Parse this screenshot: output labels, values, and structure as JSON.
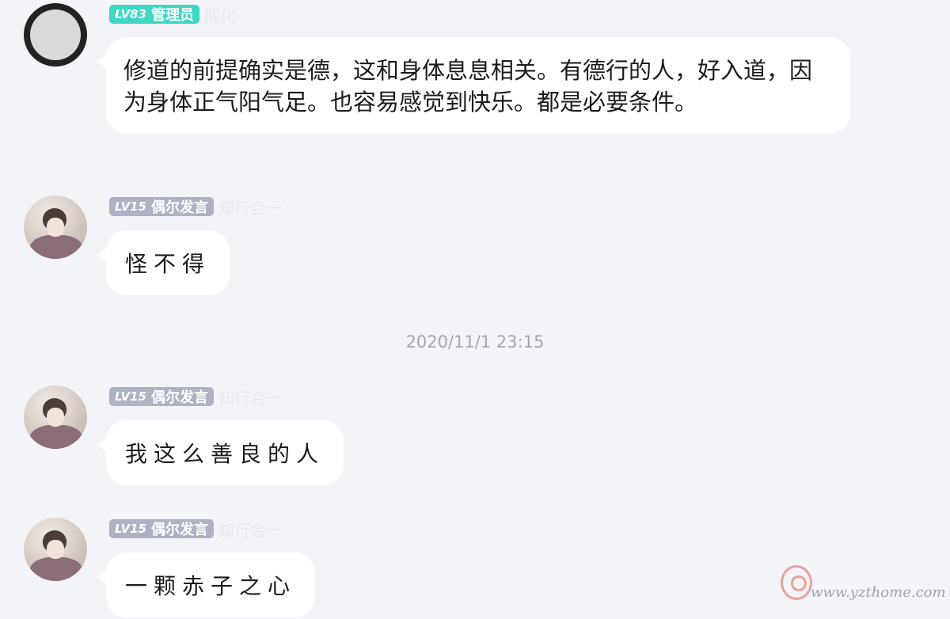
{
  "messages": [
    {
      "level": "LV83",
      "title": "管理员",
      "nickname": "醒化",
      "text": "修道的前提确实是德，这和身体息息相关。有德行的人，好入道，因为身体正气阳气足。也容易感觉到快乐。都是必要条件。"
    },
    {
      "level": "LV15",
      "title": "偶尔发言",
      "nickname": "知行合一",
      "text": "怪不得"
    },
    {
      "level": "LV15",
      "title": "偶尔发言",
      "nickname": "知行合一",
      "text": "我这么善良的人"
    },
    {
      "level": "LV15",
      "title": "偶尔发言",
      "nickname": "知行合一",
      "text": "一颗赤子之心"
    }
  ],
  "timestamp": "2020/11/1 23:15",
  "watermark": {
    "text": "www.yzthome.com"
  },
  "colors": {
    "background": "#f3f4f8",
    "admin_badge": "#3ed8c5",
    "member_badge": "#aeb3c3",
    "bubble": "#ffffff"
  }
}
